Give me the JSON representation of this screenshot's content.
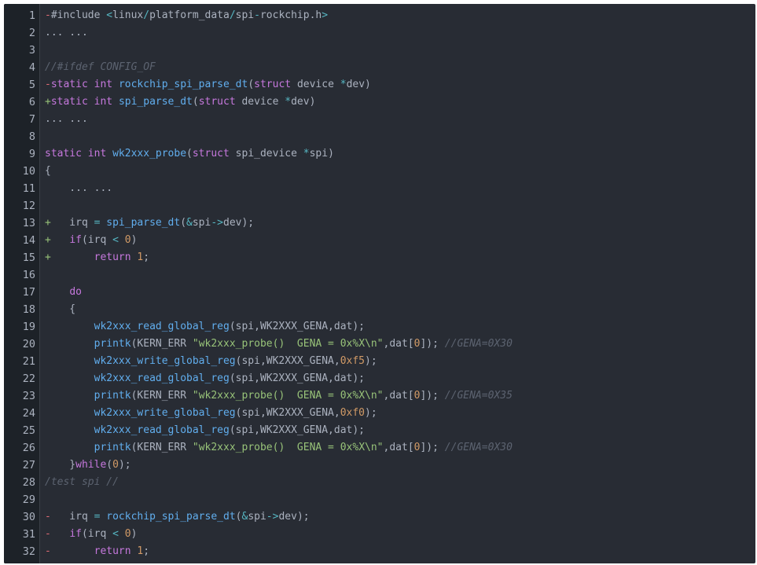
{
  "viewer": {
    "colors": {
      "background": "#282c34",
      "gutter_background": "#1d2228",
      "text": "#abb2bf",
      "keyword": "#c678dd",
      "function": "#61aeee",
      "string": "#98c379",
      "comment": "#5c6370",
      "number": "#d19a66",
      "operator": "#56b6c2"
    },
    "lines": [
      {
        "number": "1",
        "tokens": [
          {
            "t": "-",
            "c": "diffdel"
          },
          {
            "t": "#include ",
            "c": "default"
          },
          {
            "t": "<",
            "c": "operator"
          },
          {
            "t": "linux",
            "c": "default"
          },
          {
            "t": "/",
            "c": "operator"
          },
          {
            "t": "platform_data",
            "c": "default"
          },
          {
            "t": "/",
            "c": "operator"
          },
          {
            "t": "spi",
            "c": "default"
          },
          {
            "t": "-",
            "c": "operator"
          },
          {
            "t": "rockchip",
            "c": "default"
          },
          {
            "t": ".",
            "c": "default"
          },
          {
            "t": "h",
            "c": "default"
          },
          {
            "t": ">",
            "c": "operator"
          }
        ]
      },
      {
        "number": "2",
        "tokens": [
          {
            "t": "... ...",
            "c": "ellipsis"
          }
        ]
      },
      {
        "number": "3",
        "tokens": []
      },
      {
        "number": "4",
        "tokens": [
          {
            "t": "//#ifdef CONFIG_OF",
            "c": "comment"
          }
        ]
      },
      {
        "number": "5",
        "tokens": [
          {
            "t": "-",
            "c": "diffdel"
          },
          {
            "t": "static ",
            "c": "keyword"
          },
          {
            "t": "int ",
            "c": "keyword"
          },
          {
            "t": "rockchip_spi_parse_dt",
            "c": "function"
          },
          {
            "t": "(",
            "c": "punct"
          },
          {
            "t": "struct ",
            "c": "keyword"
          },
          {
            "t": "device ",
            "c": "default"
          },
          {
            "t": "*",
            "c": "operator"
          },
          {
            "t": "dev",
            "c": "default"
          },
          {
            "t": ")",
            "c": "punct"
          }
        ]
      },
      {
        "number": "6",
        "tokens": [
          {
            "t": "+",
            "c": "diffadd"
          },
          {
            "t": "static ",
            "c": "keyword"
          },
          {
            "t": "int ",
            "c": "keyword"
          },
          {
            "t": "spi_parse_dt",
            "c": "function"
          },
          {
            "t": "(",
            "c": "punct"
          },
          {
            "t": "struct ",
            "c": "keyword"
          },
          {
            "t": "device ",
            "c": "default"
          },
          {
            "t": "*",
            "c": "operator"
          },
          {
            "t": "dev",
            "c": "default"
          },
          {
            "t": ")",
            "c": "punct"
          }
        ]
      },
      {
        "number": "7",
        "tokens": [
          {
            "t": "... ...",
            "c": "ellipsis"
          }
        ]
      },
      {
        "number": "8",
        "tokens": []
      },
      {
        "number": "9",
        "tokens": [
          {
            "t": "static ",
            "c": "keyword"
          },
          {
            "t": "int ",
            "c": "keyword"
          },
          {
            "t": "wk2xxx_probe",
            "c": "function"
          },
          {
            "t": "(",
            "c": "punct"
          },
          {
            "t": "struct ",
            "c": "keyword"
          },
          {
            "t": "spi_device ",
            "c": "default"
          },
          {
            "t": "*",
            "c": "operator"
          },
          {
            "t": "spi",
            "c": "default"
          },
          {
            "t": ")",
            "c": "punct"
          }
        ]
      },
      {
        "number": "10",
        "tokens": [
          {
            "t": "{",
            "c": "punct"
          }
        ]
      },
      {
        "number": "11",
        "tokens": [
          {
            "t": "    ... ...",
            "c": "ellipsis"
          }
        ]
      },
      {
        "number": "12",
        "tokens": []
      },
      {
        "number": "13",
        "tokens": [
          {
            "t": "+",
            "c": "diffadd"
          },
          {
            "t": "   irq ",
            "c": "default"
          },
          {
            "t": "= ",
            "c": "operator"
          },
          {
            "t": "spi_parse_dt",
            "c": "function"
          },
          {
            "t": "(",
            "c": "punct"
          },
          {
            "t": "&",
            "c": "operator"
          },
          {
            "t": "spi",
            "c": "default"
          },
          {
            "t": "->",
            "c": "operator"
          },
          {
            "t": "dev",
            "c": "default"
          },
          {
            "t": ");",
            "c": "punct"
          }
        ]
      },
      {
        "number": "14",
        "tokens": [
          {
            "t": "+",
            "c": "diffadd"
          },
          {
            "t": "   ",
            "c": "default"
          },
          {
            "t": "if",
            "c": "keyword"
          },
          {
            "t": "(",
            "c": "punct"
          },
          {
            "t": "irq ",
            "c": "default"
          },
          {
            "t": "< ",
            "c": "operator"
          },
          {
            "t": "0",
            "c": "number"
          },
          {
            "t": ")",
            "c": "punct"
          }
        ]
      },
      {
        "number": "15",
        "tokens": [
          {
            "t": "+",
            "c": "diffadd"
          },
          {
            "t": "       ",
            "c": "default"
          },
          {
            "t": "return ",
            "c": "keyword"
          },
          {
            "t": "1",
            "c": "number"
          },
          {
            "t": ";",
            "c": "punct"
          }
        ]
      },
      {
        "number": "16",
        "tokens": []
      },
      {
        "number": "17",
        "tokens": [
          {
            "t": "    ",
            "c": "default"
          },
          {
            "t": "do",
            "c": "keyword"
          }
        ]
      },
      {
        "number": "18",
        "tokens": [
          {
            "t": "    {",
            "c": "punct"
          }
        ]
      },
      {
        "number": "19",
        "tokens": [
          {
            "t": "        ",
            "c": "default"
          },
          {
            "t": "wk2xxx_read_global_reg",
            "c": "function"
          },
          {
            "t": "(",
            "c": "punct"
          },
          {
            "t": "spi",
            "c": "default"
          },
          {
            "t": ",",
            "c": "punct"
          },
          {
            "t": "WK2XXX_GENA",
            "c": "default"
          },
          {
            "t": ",",
            "c": "punct"
          },
          {
            "t": "dat",
            "c": "default"
          },
          {
            "t": ");",
            "c": "punct"
          }
        ]
      },
      {
        "number": "20",
        "tokens": [
          {
            "t": "        ",
            "c": "default"
          },
          {
            "t": "printk",
            "c": "function"
          },
          {
            "t": "(",
            "c": "punct"
          },
          {
            "t": "KERN_ERR ",
            "c": "default"
          },
          {
            "t": "\"wk2xxx_probe()  GENA = 0x%X\\n\"",
            "c": "string"
          },
          {
            "t": ",",
            "c": "punct"
          },
          {
            "t": "dat",
            "c": "default"
          },
          {
            "t": "[",
            "c": "punct"
          },
          {
            "t": "0",
            "c": "number"
          },
          {
            "t": "]); ",
            "c": "punct"
          },
          {
            "t": "//GENA=0X30",
            "c": "comment"
          }
        ]
      },
      {
        "number": "21",
        "tokens": [
          {
            "t": "        ",
            "c": "default"
          },
          {
            "t": "wk2xxx_write_global_reg",
            "c": "function"
          },
          {
            "t": "(",
            "c": "punct"
          },
          {
            "t": "spi",
            "c": "default"
          },
          {
            "t": ",",
            "c": "punct"
          },
          {
            "t": "WK2XXX_GENA",
            "c": "default"
          },
          {
            "t": ",",
            "c": "punct"
          },
          {
            "t": "0xf5",
            "c": "number"
          },
          {
            "t": ");",
            "c": "punct"
          }
        ]
      },
      {
        "number": "22",
        "tokens": [
          {
            "t": "        ",
            "c": "default"
          },
          {
            "t": "wk2xxx_read_global_reg",
            "c": "function"
          },
          {
            "t": "(",
            "c": "punct"
          },
          {
            "t": "spi",
            "c": "default"
          },
          {
            "t": ",",
            "c": "punct"
          },
          {
            "t": "WK2XXX_GENA",
            "c": "default"
          },
          {
            "t": ",",
            "c": "punct"
          },
          {
            "t": "dat",
            "c": "default"
          },
          {
            "t": ");",
            "c": "punct"
          }
        ]
      },
      {
        "number": "23",
        "tokens": [
          {
            "t": "        ",
            "c": "default"
          },
          {
            "t": "printk",
            "c": "function"
          },
          {
            "t": "(",
            "c": "punct"
          },
          {
            "t": "KERN_ERR ",
            "c": "default"
          },
          {
            "t": "\"wk2xxx_probe()  GENA = 0x%X\\n\"",
            "c": "string"
          },
          {
            "t": ",",
            "c": "punct"
          },
          {
            "t": "dat",
            "c": "default"
          },
          {
            "t": "[",
            "c": "punct"
          },
          {
            "t": "0",
            "c": "number"
          },
          {
            "t": "]); ",
            "c": "punct"
          },
          {
            "t": "//GENA=0X35",
            "c": "comment"
          }
        ]
      },
      {
        "number": "24",
        "tokens": [
          {
            "t": "        ",
            "c": "default"
          },
          {
            "t": "wk2xxx_write_global_reg",
            "c": "function"
          },
          {
            "t": "(",
            "c": "punct"
          },
          {
            "t": "spi",
            "c": "default"
          },
          {
            "t": ",",
            "c": "punct"
          },
          {
            "t": "WK2XXX_GENA",
            "c": "default"
          },
          {
            "t": ",",
            "c": "punct"
          },
          {
            "t": "0xf0",
            "c": "number"
          },
          {
            "t": ");",
            "c": "punct"
          }
        ]
      },
      {
        "number": "25",
        "tokens": [
          {
            "t": "        ",
            "c": "default"
          },
          {
            "t": "wk2xxx_read_global_reg",
            "c": "function"
          },
          {
            "t": "(",
            "c": "punct"
          },
          {
            "t": "spi",
            "c": "default"
          },
          {
            "t": ",",
            "c": "punct"
          },
          {
            "t": "WK2XXX_GENA",
            "c": "default"
          },
          {
            "t": ",",
            "c": "punct"
          },
          {
            "t": "dat",
            "c": "default"
          },
          {
            "t": ");",
            "c": "punct"
          }
        ]
      },
      {
        "number": "26",
        "tokens": [
          {
            "t": "        ",
            "c": "default"
          },
          {
            "t": "printk",
            "c": "function"
          },
          {
            "t": "(",
            "c": "punct"
          },
          {
            "t": "KERN_ERR ",
            "c": "default"
          },
          {
            "t": "\"wk2xxx_probe()  GENA = 0x%X\\n\"",
            "c": "string"
          },
          {
            "t": ",",
            "c": "punct"
          },
          {
            "t": "dat",
            "c": "default"
          },
          {
            "t": "[",
            "c": "punct"
          },
          {
            "t": "0",
            "c": "number"
          },
          {
            "t": "]); ",
            "c": "punct"
          },
          {
            "t": "//GENA=0X30",
            "c": "comment"
          }
        ]
      },
      {
        "number": "27",
        "tokens": [
          {
            "t": "    }",
            "c": "punct"
          },
          {
            "t": "while",
            "c": "keyword"
          },
          {
            "t": "(",
            "c": "punct"
          },
          {
            "t": "0",
            "c": "number"
          },
          {
            "t": ");",
            "c": "punct"
          }
        ]
      },
      {
        "number": "28",
        "tokens": [
          {
            "t": "/test spi //",
            "c": "comment"
          }
        ]
      },
      {
        "number": "29",
        "tokens": []
      },
      {
        "number": "30",
        "tokens": [
          {
            "t": "-",
            "c": "diffdel"
          },
          {
            "t": "   irq ",
            "c": "default"
          },
          {
            "t": "= ",
            "c": "operator"
          },
          {
            "t": "rockchip_spi_parse_dt",
            "c": "function"
          },
          {
            "t": "(",
            "c": "punct"
          },
          {
            "t": "&",
            "c": "operator"
          },
          {
            "t": "spi",
            "c": "default"
          },
          {
            "t": "->",
            "c": "operator"
          },
          {
            "t": "dev",
            "c": "default"
          },
          {
            "t": ");",
            "c": "punct"
          }
        ]
      },
      {
        "number": "31",
        "tokens": [
          {
            "t": "-",
            "c": "diffdel"
          },
          {
            "t": "   ",
            "c": "default"
          },
          {
            "t": "if",
            "c": "keyword"
          },
          {
            "t": "(",
            "c": "punct"
          },
          {
            "t": "irq ",
            "c": "default"
          },
          {
            "t": "< ",
            "c": "operator"
          },
          {
            "t": "0",
            "c": "number"
          },
          {
            "t": ")",
            "c": "punct"
          }
        ]
      },
      {
        "number": "32",
        "tokens": [
          {
            "t": "-",
            "c": "diffdel"
          },
          {
            "t": "       ",
            "c": "default"
          },
          {
            "t": "return ",
            "c": "keyword"
          },
          {
            "t": "1",
            "c": "number"
          },
          {
            "t": ";",
            "c": "punct"
          }
        ]
      }
    ]
  }
}
